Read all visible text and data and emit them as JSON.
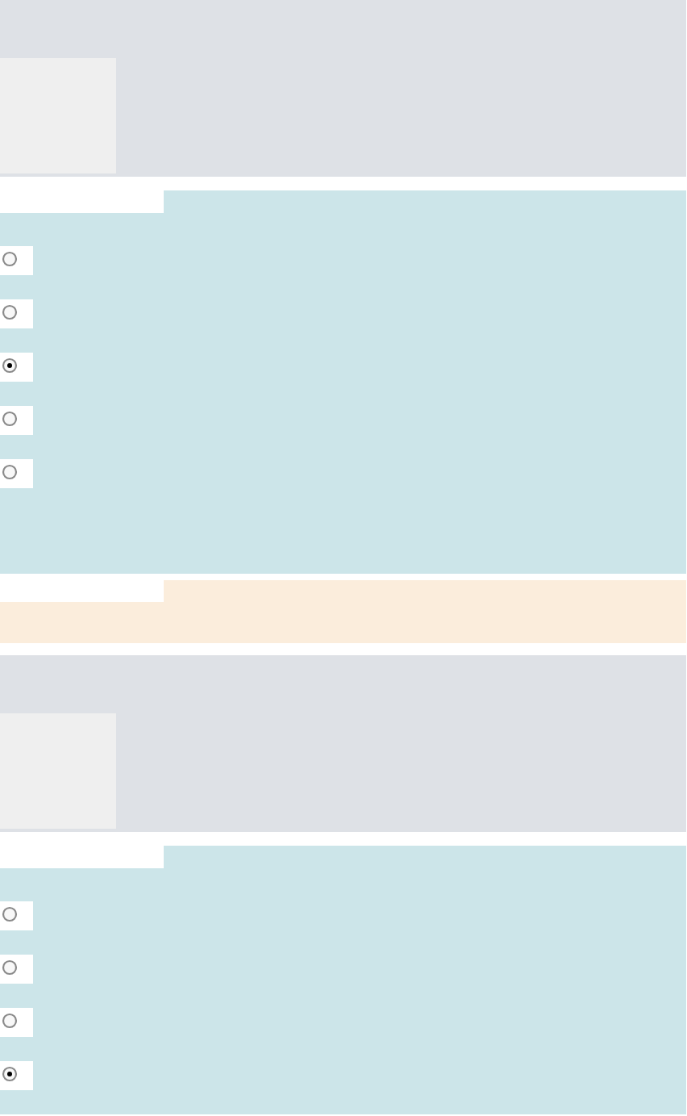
{
  "blocks": [
    {
      "kind": "question",
      "options": [
        {
          "selected": false
        },
        {
          "selected": false
        },
        {
          "selected": true
        },
        {
          "selected": false
        },
        {
          "selected": false
        }
      ]
    },
    {
      "kind": "notice"
    },
    {
      "kind": "question",
      "options": [
        {
          "selected": false
        },
        {
          "selected": false
        },
        {
          "selected": false
        },
        {
          "selected": true
        }
      ]
    }
  ]
}
